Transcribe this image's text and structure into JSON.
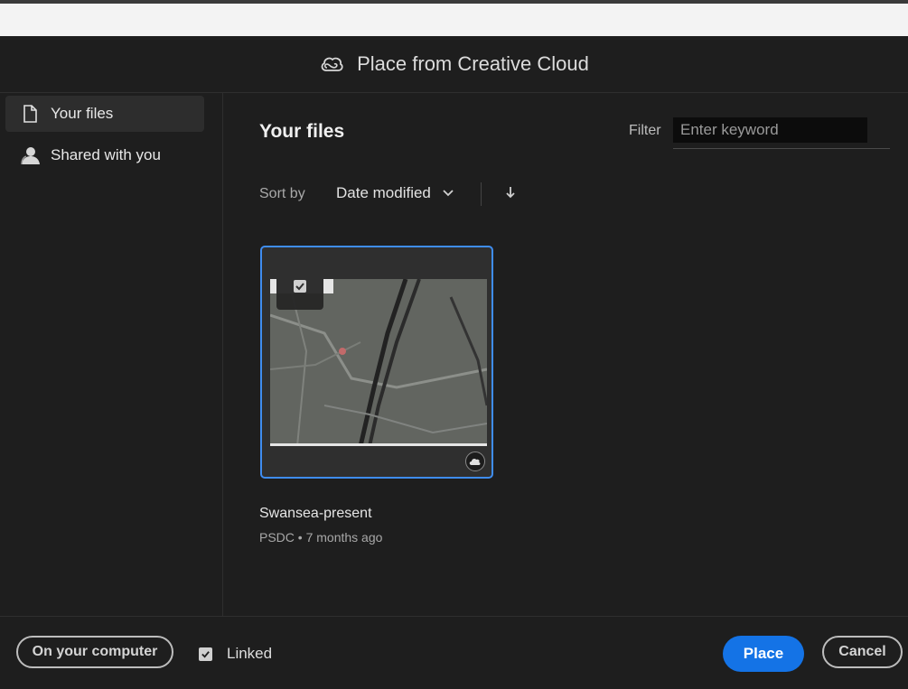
{
  "dialog": {
    "title": "Place from Creative Cloud",
    "cc_icon": "creative-cloud-icon"
  },
  "sidebar": {
    "items": [
      {
        "label": "Your files",
        "icon": "file-icon",
        "active": true
      },
      {
        "label": "Shared with you",
        "icon": "user-icon",
        "active": false
      }
    ]
  },
  "main": {
    "heading": "Your files",
    "filter": {
      "label": "Filter",
      "placeholder": "Enter keyword",
      "value": ""
    },
    "sort": {
      "label": "Sort by",
      "value": "Date modified",
      "direction_icon": "arrow-down-icon"
    }
  },
  "files": [
    {
      "name": "Swansea-present",
      "meta": "PSDC • 7 months ago",
      "selected": true,
      "badge": "cloud-icon"
    }
  ],
  "footer": {
    "on_computer_label": "On your computer",
    "linked_label": "Linked",
    "linked_checked": true,
    "place_label": "Place",
    "cancel_label": "Cancel"
  },
  "colors": {
    "background": "#1e1e1e",
    "accent": "#1473e6",
    "selection_border": "#3f8df0"
  }
}
